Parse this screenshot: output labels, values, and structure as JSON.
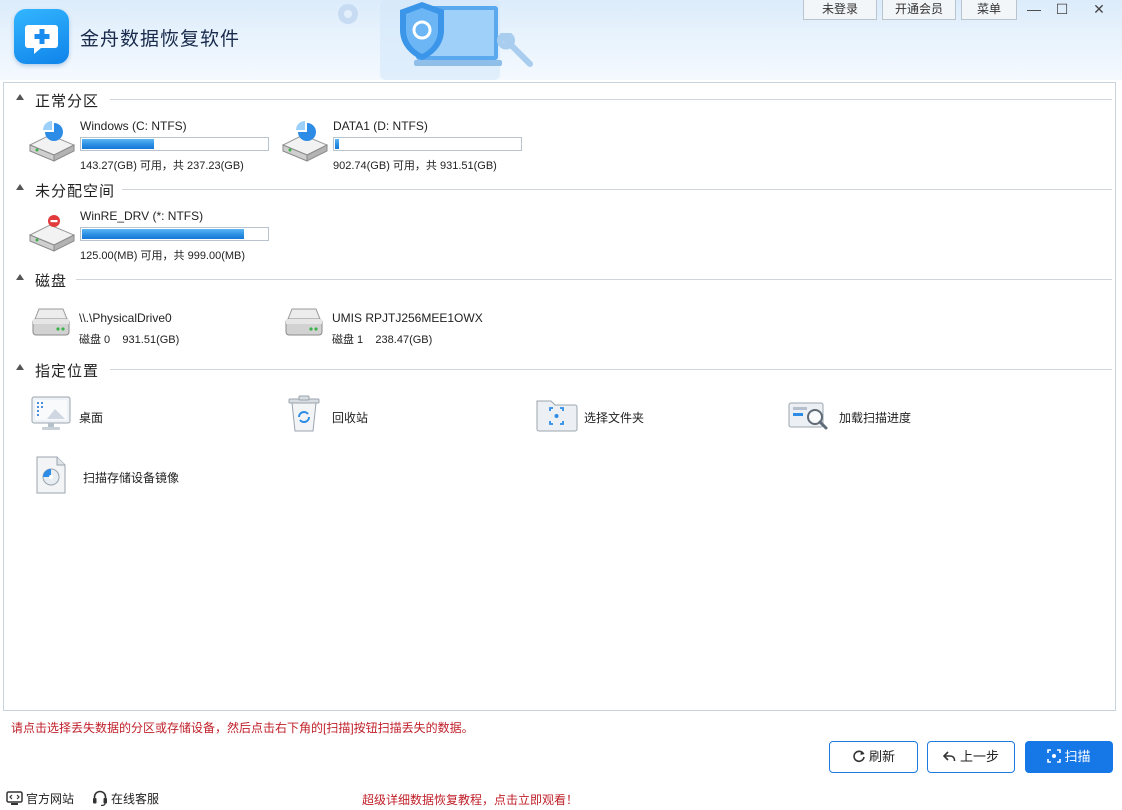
{
  "app": {
    "title": "金舟数据恢复软件"
  },
  "top_buttons": {
    "login": "未登录",
    "vip": "开通会员",
    "menu": "菜单"
  },
  "window_controls": {
    "minimize": "—",
    "maximize": "☐",
    "close": "✕"
  },
  "sections": {
    "partitions": "正常分区",
    "unallocated": "未分配空间",
    "disks": "磁盘",
    "locations": "指定位置"
  },
  "partitions": [
    {
      "name": "Windows (C: NTFS)",
      "info": "143.27(GB) 可用，共 237.23(GB)",
      "used_fraction": 0.396
    },
    {
      "name": "DATA1 (D: NTFS)",
      "info": "902.74(GB) 可用，共 931.51(GB)",
      "used_fraction": 0.031
    }
  ],
  "unallocated": [
    {
      "name": "WinRE_DRV (*: NTFS)",
      "info": "125.00(MB) 可用，共 999.00(MB)",
      "used_fraction": 0.875
    }
  ],
  "disks": [
    {
      "name": "\\\\.\\PhysicalDrive0",
      "label": "磁盘 0",
      "size": "931.51(GB)"
    },
    {
      "name": "UMIS RPJTJ256MEE1OWX",
      "label": "磁盘 1",
      "size": "238.47(GB)"
    }
  ],
  "locations": {
    "desktop": "桌面",
    "recycle_bin": "回收站",
    "choose_folder": "选择文件夹",
    "load_progress": "加载扫描进度",
    "image_scan": "扫描存储设备镜像"
  },
  "footer": {
    "hint": "请点击选择丢失数据的分区或存储设备，然后点击右下角的[扫描]按钮扫描丢失的数据。",
    "refresh": "刷新",
    "back": "上一步",
    "scan": "扫描",
    "website": "官方网站",
    "support": "在线客服",
    "promo": "超级详细数据恢复教程，点击立即观看！"
  },
  "colors": {
    "accent": "#1677e6",
    "hint_red": "#c0202a",
    "bar_fill": "#2b8fe3"
  },
  "icons": [
    "app-logo-icon",
    "drive-icon",
    "drive-error-icon",
    "disk-icon",
    "desktop-icon",
    "recycle-bin-icon",
    "folder-scan-icon",
    "load-progress-icon",
    "disk-image-icon",
    "refresh-icon",
    "back-icon",
    "scan-icon",
    "website-icon",
    "headset-icon"
  ]
}
